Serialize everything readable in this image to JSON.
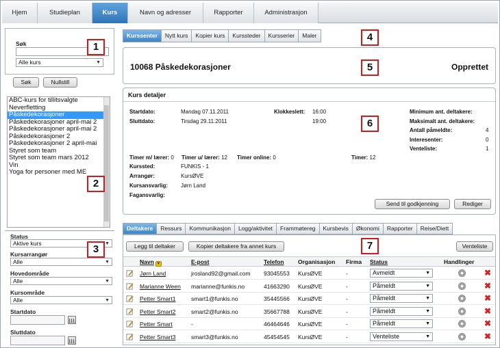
{
  "topnav": [
    "Hjem",
    "Studieplan",
    "Kurs",
    "Navn og adresser",
    "Rapporter",
    "Administrasjon"
  ],
  "left": {
    "search_label": "Søk",
    "search_value": "",
    "course_filter": "Alle kurs",
    "search_button": "Søk",
    "reset_button": "Nullstill",
    "courses": [
      "ABC-kurs for tillitsvalgte",
      "Neverfletting",
      "Påskedekorasjoner",
      "Påskedekorasjoner april-mai 2",
      "Påskedekorasjoner april-mai 2",
      "Påskedekorasjoner 2",
      "Påskedekorasjoner 2 april-mai",
      "Styret som team",
      "Styret som team mars 2012",
      "Vin",
      "Yoga for personer med ME"
    ],
    "selected_course_index": 2,
    "status_label": "Status",
    "status_value": "Aktive kurs",
    "organizer_label": "Kursarrangør",
    "organizer_value": "Alle",
    "mainarea_label": "Hovedområde",
    "mainarea_value": "Alle",
    "area_label": "Kursområde",
    "area_value": "Alle",
    "startdate_label": "Startdato",
    "enddate_label": "Sluttdato"
  },
  "markers": [
    "1",
    "2",
    "3",
    "4",
    "5",
    "6",
    "7"
  ],
  "subtabs": [
    "Kurssenter",
    "Nytt kurs",
    "Kopier kurs",
    "Kurssteder",
    "Kursserier",
    "Maler"
  ],
  "course": {
    "title": "10068 Påskedekorasjoner",
    "status": "Opprettet"
  },
  "details": {
    "heading": "Kurs detaljer",
    "startdato_label": "Startdato:",
    "startdato_value": "Mandag 07.11.2011",
    "sluttdato_label": "Sluttdato:",
    "sluttdato_value": "Tirsdag 29.11.2011",
    "klokkeslett_label": "Klokkeslett:",
    "klokkeslett_start": "16:00",
    "klokkeslett_end": "19:00",
    "min_label": "Minimum ant. deltakere:",
    "min_value": "",
    "max_label": "Maksimalt ant. deltakere:",
    "max_value": "",
    "pameldte_label": "Antall påmeldte:",
    "pameldte_value": "4",
    "interesenter_label": "Interesenter:",
    "interesenter_value": "0",
    "venteliste_label": "Venteliste:",
    "venteliste_value": "1",
    "timer_med_label": "Timer m/ lærer:",
    "timer_med_value": "0",
    "timer_uten_label": "Timer u/ lærer:",
    "timer_uten_value": "12",
    "timer_online_label": "Timer online:",
    "timer_online_value": "0",
    "timer_label": "Timer:",
    "timer_value": "12",
    "kurssted_label": "Kurssted:",
    "kurssted_value": "FUNKIS - 1",
    "arrangor_label": "Arrangør:",
    "arrangor_value": "KursØVE",
    "ansvarlig_label": "Kursansvarlig:",
    "ansvarlig_value": "Jørn Land",
    "fagansvarlig_label": "Fagansvarlig:",
    "fagansvarlig_value": "",
    "send_button": "Send til godkjenning",
    "edit_button": "Rediger"
  },
  "bottomtabs": [
    "Deltakere",
    "Ressurs",
    "Kommunikasjon",
    "Logg/aktivitet",
    "Frammøtereg",
    "Kursbevis",
    "Økonomi",
    "Rapporter",
    "Reise/Diett"
  ],
  "participants": {
    "add_button": "Legg til deltaker",
    "copy_button": "Kopier deltakere fra annet kurs",
    "waitlist_button": "Venteliste",
    "columns": [
      "Navn",
      "E-post",
      "Telefon",
      "Organisasjon",
      "Firma",
      "Status",
      "Handlinger"
    ],
    "rows": [
      {
        "name": "Jørn Land",
        "email": "jrosland92@gmail.com",
        "phone": "93045553",
        "org": "KursØVE",
        "firm": "-",
        "status": "Avmeldt"
      },
      {
        "name": "Marianne Ween",
        "email": "marianne@funkis.no",
        "phone": "41663290",
        "org": "KursØVE",
        "firm": "-",
        "status": "Påmeldt"
      },
      {
        "name": "Petter Smart1",
        "email": "smart1@funkis.no",
        "phone": "35445566",
        "org": "KursØVE",
        "firm": "-",
        "status": "Påmeldt"
      },
      {
        "name": "Petter Smart2",
        "email": "smart2@funkis.no",
        "phone": "35667788",
        "org": "KursØVE",
        "firm": "-",
        "status": "Påmeldt"
      },
      {
        "name": "Petter Smart",
        "email": "-",
        "phone": "46464646",
        "org": "KursØVE",
        "firm": "-",
        "status": "Påmeldt"
      },
      {
        "name": "Petter Smart3",
        "email": "smart3@funkis.no",
        "phone": "45454545",
        "org": "KursØVE",
        "firm": "-",
        "status": "Venteliste"
      }
    ]
  }
}
